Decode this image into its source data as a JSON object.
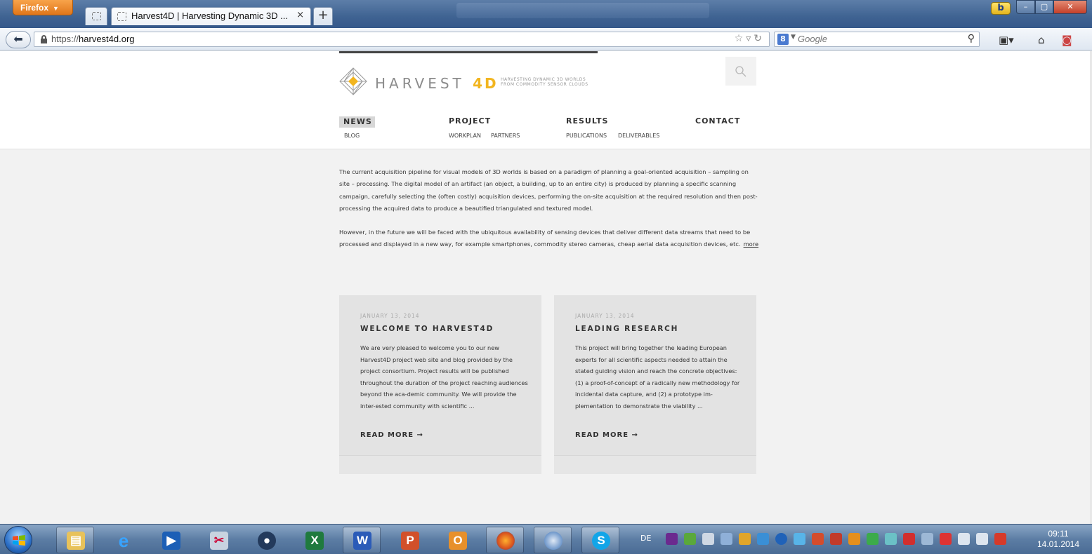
{
  "browser": {
    "menu_label": "Firefox",
    "tab_title": "Harvest4D | Harvesting Dynamic 3D ...",
    "tab_close": "×",
    "new_tab": "+",
    "url_host": "harvest4d.org",
    "url_prefix": "https://",
    "search_placeholder": "Google",
    "bing_label": "b"
  },
  "site": {
    "logo_word": "HARVEST",
    "logo_accent": "4D",
    "tagline_1": "HARVESTING DYNAMIC 3D WORLDS",
    "tagline_2": "FROM COMMODITY SENSOR CLOUDS",
    "nav": [
      {
        "label": "NEWS",
        "subs": [
          "BLOG"
        ]
      },
      {
        "label": "PROJECT",
        "subs": [
          "WORKPLAN",
          "PARTNERS"
        ]
      },
      {
        "label": "RESULTS",
        "subs": [
          "PUBLICATIONS",
          "DELIVERABLES"
        ]
      },
      {
        "label": "CONTACT",
        "subs": []
      }
    ],
    "intro_p1": "The current acquisition pipeline for visual models of 3D worlds is based on a paradigm of planning a goal-oriented acquisition – sampling on site – processing. The digital model of an artifact (an object, a building, up to an entire city) is produced by planning a specific scanning campaign, carefully selecting the (often costly) acquisition devices, performing the on-site acquisition at the required resolution and then post-processing the acquired data to produce a beautified triangulated and textured model.",
    "intro_p2": "However, in the future we will be faced with the ubiquitous availability of sensing devices that deliver different data streams that need to be processed and displayed in a new way, for example smartphones, commodity stereo cameras, cheap aerial data acquisition devices, etc.",
    "more_link": "more",
    "posts": [
      {
        "date": "JANUARY 13, 2014",
        "title": "WELCOME TO HARVEST4D",
        "body": "We are very pleased to welcome you to our new Harvest4D project web site and blog provided by the project consortium. Project results will be published throughout the duration of the project reaching audiences beyond the aca-demic community. We will provide the inter-ested community with scientific ...",
        "read_more": "READ MORE →"
      },
      {
        "date": "JANUARY 13, 2014",
        "title": "LEADING RESEARCH",
        "body": "This project will bring together the leading European experts for all scientific aspects needed to attain the stated guiding vision and reach the concrete objectives: (1) a proof-of-concept of a radically new methodology for incidental data capture, and (2) a prototype im-plementation to demonstrate the viability ...",
        "read_more": "READ MORE →"
      }
    ]
  },
  "taskbar": {
    "language": "DE",
    "time": "09:11",
    "date": "14.01.2014"
  },
  "colors": {
    "accent_yellow": "#f2b51f",
    "text_dark": "#333333",
    "card_bg": "#e3e3e3"
  }
}
